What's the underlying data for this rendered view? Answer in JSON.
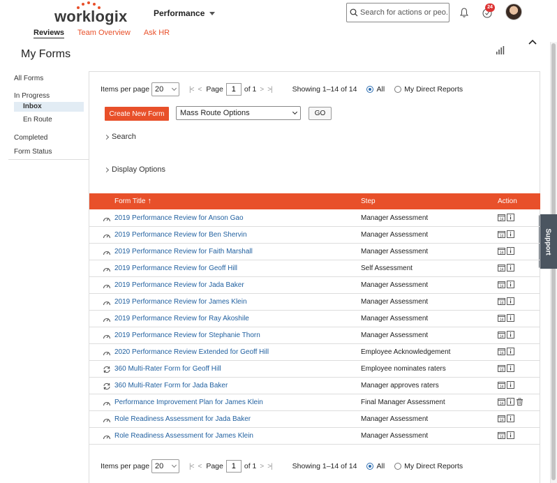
{
  "brand": {
    "name": "worklogix",
    "accent": "#e8502a"
  },
  "header": {
    "module": "Performance",
    "search_placeholder": "Search for actions or peo...",
    "notification_count": "24"
  },
  "subnav": {
    "items": [
      "Reviews",
      "Team Overview",
      "Ask HR"
    ],
    "active": "Reviews"
  },
  "page": {
    "title": "My Forms"
  },
  "support": "Support",
  "sidebar": {
    "all_forms": "All Forms",
    "in_progress": "In Progress",
    "inbox": "Inbox",
    "en_route": "En Route",
    "completed": "Completed",
    "form_status": "Form Status"
  },
  "pagination": {
    "items_per_page_label": "Items per page",
    "items_per_page": "20",
    "page_label": "Page",
    "page": "1",
    "of_pages": "of 1",
    "showing": "Showing 1–14 of 14",
    "radio_all": "All",
    "radio_direct": "My Direct Reports"
  },
  "actions": {
    "create_new_form": "Create New Form",
    "mass_route": "Mass Route Options",
    "go": "GO"
  },
  "expanders": {
    "search": "Search",
    "display_options": "Display Options"
  },
  "table": {
    "headers": {
      "title": "Form Title",
      "step": "Step",
      "action": "Action"
    },
    "rows": [
      {
        "title": "2019 Performance Review for Anson Gao",
        "step": "Manager Assessment",
        "icon": "gauge-icon",
        "delete": false
      },
      {
        "title": "2019 Performance Review for Ben Shervin",
        "step": "Manager Assessment",
        "icon": "gauge-icon",
        "delete": false
      },
      {
        "title": "2019 Performance Review for Faith Marshall",
        "step": "Manager Assessment",
        "icon": "gauge-icon",
        "delete": false
      },
      {
        "title": "2019 Performance Review for Geoff Hill",
        "step": "Self Assessment",
        "icon": "gauge-icon",
        "delete": false
      },
      {
        "title": "2019 Performance Review for Jada Baker",
        "step": "Manager Assessment",
        "icon": "gauge-icon",
        "delete": false
      },
      {
        "title": "2019 Performance Review for James Klein",
        "step": "Manager Assessment",
        "icon": "gauge-icon",
        "delete": false
      },
      {
        "title": "2019 Performance Review for Ray Akoshile",
        "step": "Manager Assessment",
        "icon": "gauge-icon",
        "delete": false
      },
      {
        "title": "2019 Performance Review for Stephanie Thorn",
        "step": "Manager Assessment",
        "icon": "gauge-icon",
        "delete": false
      },
      {
        "title": "2020 Performance Review Extended for Geoff Hill",
        "step": "Employee Acknowledgement",
        "icon": "gauge-icon",
        "delete": false
      },
      {
        "title": "360 Multi-Rater Form for Geoff Hill",
        "step": "Employee nominates raters",
        "icon": "cycle-icon",
        "delete": false
      },
      {
        "title": "360 Multi-Rater Form for Jada Baker",
        "step": "Manager approves raters",
        "icon": "cycle-icon",
        "delete": false
      },
      {
        "title": "Performance Improvement Plan for James Klein",
        "step": "Final Manager Assessment",
        "icon": "gauge-icon",
        "delete": true
      },
      {
        "title": "Role Readiness Assessment for Jada Baker",
        "step": "Manager Assessment",
        "icon": "gauge-icon",
        "delete": false
      },
      {
        "title": "Role Readiness Assessment for James Klein",
        "step": "Manager Assessment",
        "icon": "gauge-icon",
        "delete": false
      }
    ]
  }
}
